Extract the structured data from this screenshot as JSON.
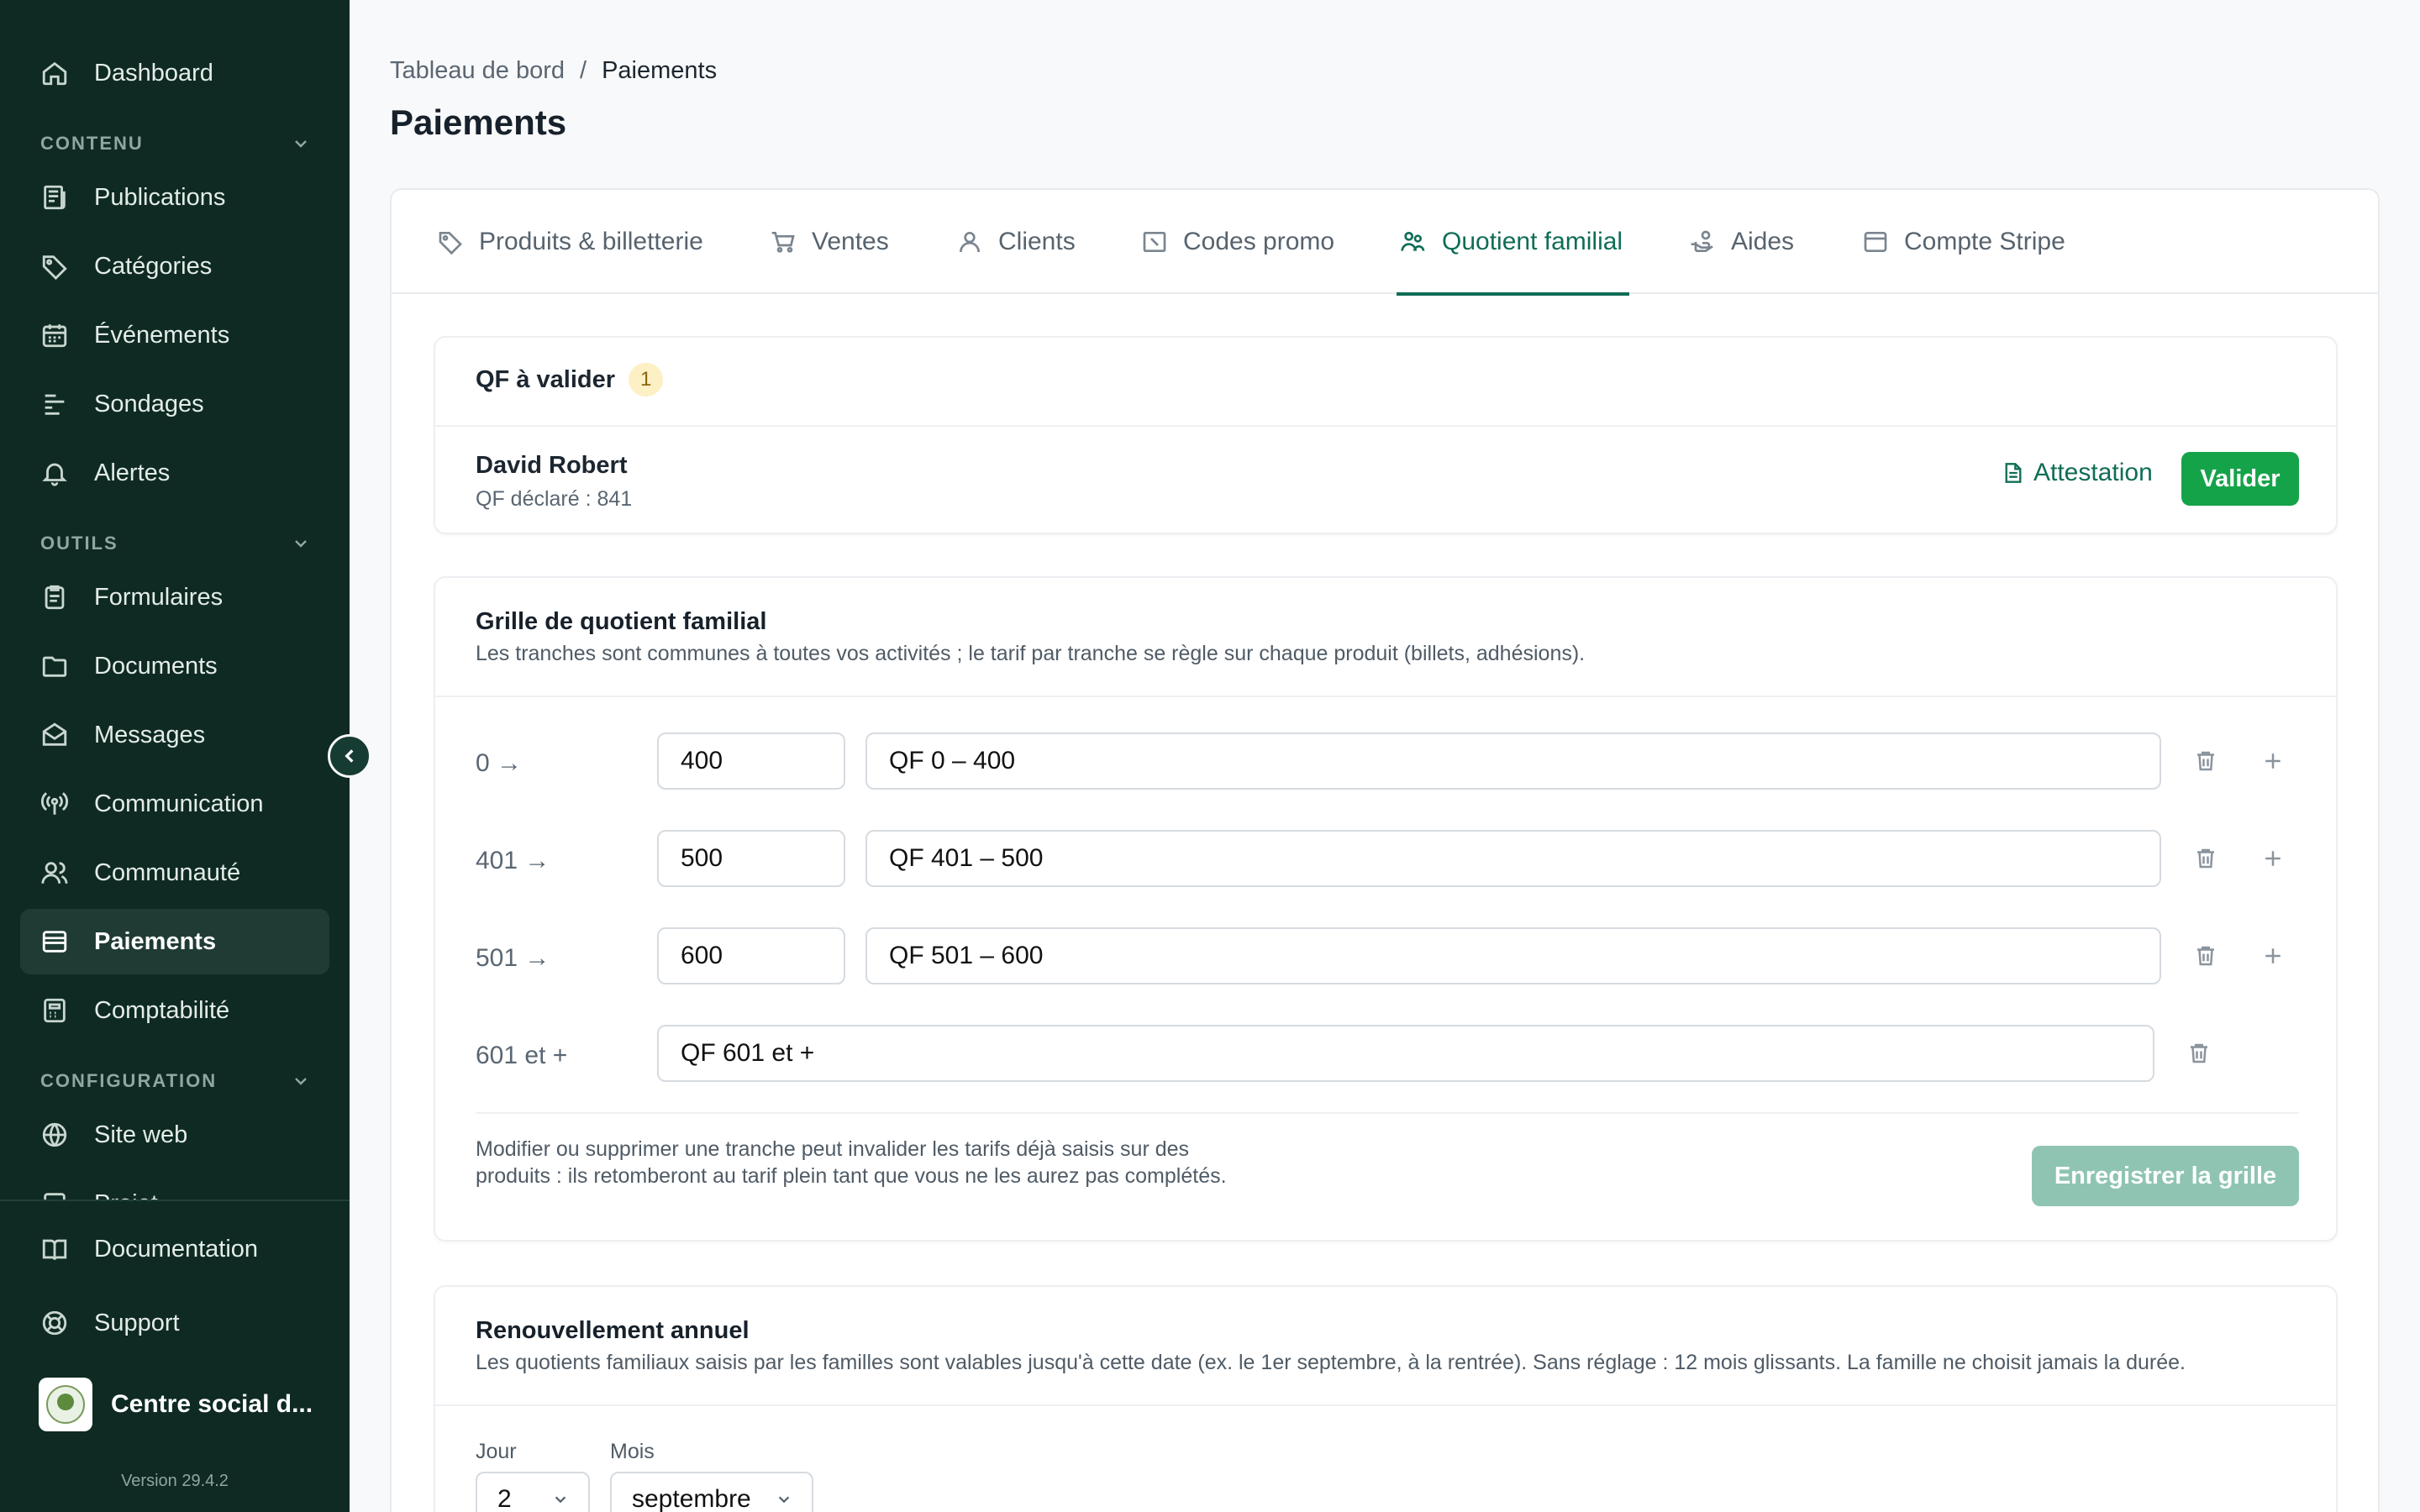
{
  "sidebar": {
    "items": [
      {
        "label": "Dashboard",
        "icon": "home-icon"
      },
      {
        "label": "Publications",
        "icon": "newspaper-icon"
      },
      {
        "label": "Catégories",
        "icon": "tag-icon"
      },
      {
        "label": "Événements",
        "icon": "calendar-icon"
      },
      {
        "label": "Sondages",
        "icon": "poll-icon"
      },
      {
        "label": "Alertes",
        "icon": "bell-icon"
      },
      {
        "label": "Formulaires",
        "icon": "clipboard-icon"
      },
      {
        "label": "Documents",
        "icon": "folder-icon"
      },
      {
        "label": "Messages",
        "icon": "mail-icon"
      },
      {
        "label": "Communication",
        "icon": "broadcast-icon"
      },
      {
        "label": "Communauté",
        "icon": "users-icon"
      },
      {
        "label": "Paiements",
        "icon": "card-icon"
      },
      {
        "label": "Comptabilité",
        "icon": "calculator-icon"
      },
      {
        "label": "Site web",
        "icon": "globe-icon"
      },
      {
        "label": "Projet",
        "icon": "project-icon"
      }
    ],
    "sections": {
      "contenu": "CONTENU",
      "outils": "OUTILS",
      "configuration": "CONFIGURATION"
    },
    "footer": {
      "documentation": "Documentation",
      "support": "Support",
      "org_name": "Centre social d...",
      "version": "Version 29.4.2"
    }
  },
  "breadcrumb": {
    "root": "Tableau de bord",
    "separator": "/",
    "current": "Paiements"
  },
  "page_title": "Paiements",
  "tabs": [
    {
      "label": "Produits & billetterie",
      "icon": "tag-icon"
    },
    {
      "label": "Ventes",
      "icon": "cart-icon"
    },
    {
      "label": "Clients",
      "icon": "user-icon"
    },
    {
      "label": "Codes promo",
      "icon": "ticket-icon"
    },
    {
      "label": "Quotient familial",
      "icon": "family-icon",
      "active": true
    },
    {
      "label": "Aides",
      "icon": "hand-coins-icon"
    },
    {
      "label": "Compte Stripe",
      "icon": "stripe-card-icon"
    }
  ],
  "qf_pending": {
    "title": "QF à valider",
    "count": "1",
    "person": "David Robert",
    "declared": "QF déclaré : 841",
    "attestation": "Attestation",
    "validate": "Valider"
  },
  "grid": {
    "title": "Grille de quotient familial",
    "description": "Les tranches sont communes à toutes vos activités ; le tarif par tranche se règle sur chaque produit (billets, adhésions).",
    "rows": [
      {
        "from": "0 →",
        "max": "400",
        "label": "QF 0 – 400"
      },
      {
        "from": "401 →",
        "max": "500",
        "label": "QF 401 – 500"
      },
      {
        "from": "501 →",
        "max": "600",
        "label": "QF 501 – 600"
      }
    ],
    "last_row": {
      "from": "601 et +",
      "label": "QF 601 et +"
    },
    "warning": "Modifier ou supprimer une tranche peut invalider les tarifs déjà saisis sur des produits : ils retomberont au tarif plein tant que vous ne les aurez pas complétés.",
    "save": "Enregistrer la grille"
  },
  "renewal": {
    "title": "Renouvellement annuel",
    "description": "Les quotients familiaux saisis par les familles sont valables jusqu'à cette date (ex. le 1er septembre, à la rentrée). Sans réglage : 12 mois glissants. La famille ne choisit jamais la durée.",
    "day_label": "Jour",
    "day_value": "2",
    "month_label": "Mois",
    "month_value": "septembre"
  },
  "colors": {
    "sidebar": "#0e2a23",
    "accent": "#0f6d56",
    "success": "#15a34a",
    "disabled_button": "#8fc4b3"
  }
}
